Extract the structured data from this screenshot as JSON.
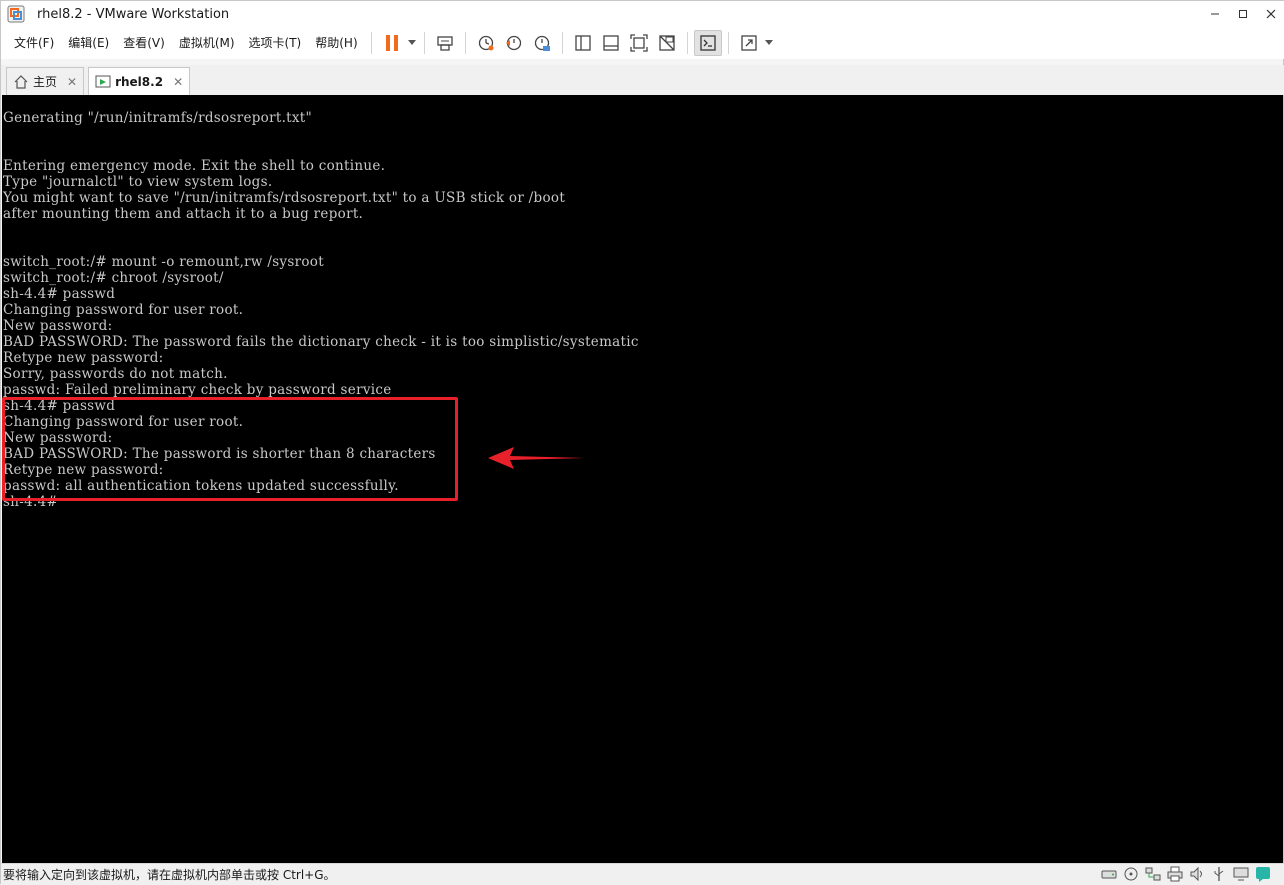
{
  "window": {
    "title": "rhel8.2 - VMware Workstation",
    "app_icon": "vmware-icon",
    "controls": [
      "minimize-icon",
      "maximize-icon",
      "close-icon"
    ]
  },
  "menu": {
    "items": [
      {
        "label": "文件(F)"
      },
      {
        "label": "编辑(E)"
      },
      {
        "label": "查看(V)"
      },
      {
        "label": "虚拟机(M)"
      },
      {
        "label": "选项卡(T)"
      },
      {
        "label": "帮助(H)"
      }
    ]
  },
  "toolbar": {
    "icons": [
      "pause-icon",
      "chevron-down-icon",
      "send-ctrl-alt-del-icon",
      "snapshot-icon",
      "revert-snapshot-icon",
      "snapshot-manager-icon",
      "library-icon",
      "thumbnail-bar-icon",
      "fullscreen-icon",
      "unity-icon",
      "console-view-icon",
      "stretch-icon",
      "chevron-down-icon"
    ],
    "accent_color": "#f26b1d"
  },
  "tabs": [
    {
      "label": "主页",
      "icon": "home-icon",
      "active": false
    },
    {
      "label": "rhel8.2",
      "icon": "vm-icon",
      "active": true
    }
  ],
  "console": {
    "lines": [
      "Generating \"/run/initramfs/rdsosreport.txt\"",
      "",
      "",
      "Entering emergency mode. Exit the shell to continue.",
      "Type \"journalctl\" to view system logs.",
      "You might want to save \"/run/initramfs/rdsosreport.txt\" to a USB stick or /boot",
      "after mounting them and attach it to a bug report.",
      "",
      "",
      "switch_root:/# mount -o remount,rw /sysroot",
      "switch_root:/# chroot /sysroot/",
      "sh-4.4# passwd",
      "Changing password for user root.",
      "New password:",
      "BAD PASSWORD: The password fails the dictionary check - it is too simplistic/systematic",
      "Retype new password:",
      "Sorry, passwords do not match.",
      "passwd: Failed preliminary check by password service",
      "sh-4.4# passwd",
      "Changing password for user root.",
      "New password:",
      "BAD PASSWORD: The password is shorter than 8 characters",
      "Retype new password:",
      "passwd: all authentication tokens updated successfully.",
      "sh-4.4#"
    ],
    "annotation_color": "#e8202a"
  },
  "statusbar": {
    "text": "要将输入定向到该虚拟机，请在虚拟机内部单击或按 Ctrl+G。",
    "icons": [
      "hard-disk-icon",
      "cd-icon",
      "network-icon",
      "printer-icon",
      "sound-icon",
      "usb-icon",
      "display-icon",
      "message-icon"
    ]
  }
}
